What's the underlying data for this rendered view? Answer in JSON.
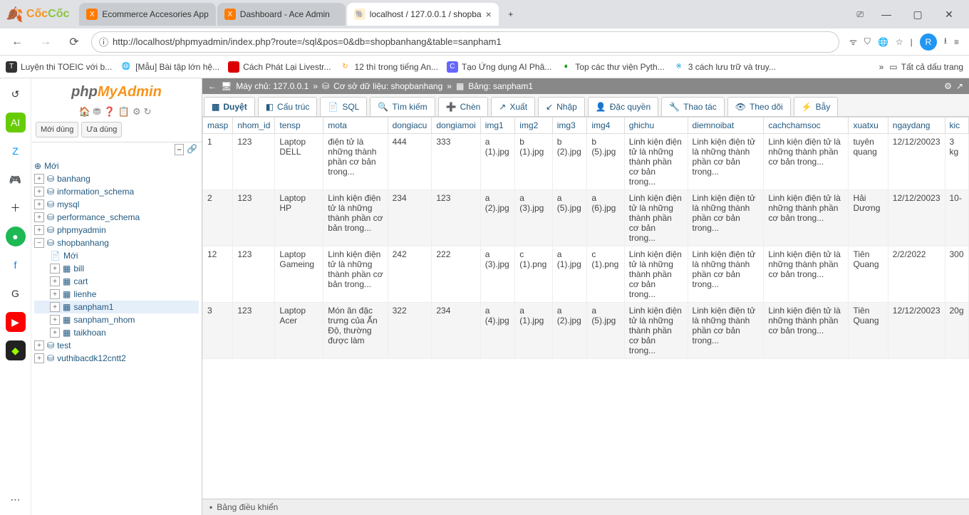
{
  "browser": {
    "brand": "CốcCốc",
    "tabs": [
      {
        "title": "Ecommerce Accesories App",
        "fav": "X",
        "favClass": "orange"
      },
      {
        "title": "Dashboard - Ace Admin",
        "fav": "X",
        "favClass": "orange"
      },
      {
        "title": "localhost / 127.0.0.1 / shopba",
        "fav": "pM",
        "favClass": "pma",
        "active": true
      }
    ],
    "url": "http://localhost/phpmyadmin/index.php?route=/sql&pos=0&db=shopbanhang&table=sanpham1",
    "avatar": "R",
    "bookmarks": [
      {
        "label": "Luyện thi TOEIC với b..."
      },
      {
        "label": "[Mẫu] Bài tập lớn hệ..."
      },
      {
        "label": "Cách Phát Lại Livestr..."
      },
      {
        "label": "12 thì trong tiếng An..."
      },
      {
        "label": "Tạo Ứng dụng AI Phâ..."
      },
      {
        "label": "Top các thư viện Pyth..."
      },
      {
        "label": "3 cách lưu trữ và truy..."
      }
    ],
    "bookmarkAll": "Tất cả dấu trang"
  },
  "pma": {
    "logo": {
      "p1": "php",
      "p2": "MyAdmin"
    },
    "recent": "Mới dùng",
    "favorites": "Ưa dùng",
    "tree": {
      "new": "Mới",
      "dbs": [
        {
          "name": "banhang"
        },
        {
          "name": "information_schema"
        },
        {
          "name": "mysql"
        },
        {
          "name": "performance_schema"
        },
        {
          "name": "phpmyadmin"
        },
        {
          "name": "shopbanhang",
          "expanded": true,
          "children": [
            {
              "name": "Mới",
              "type": "new"
            },
            {
              "name": "bill"
            },
            {
              "name": "cart"
            },
            {
              "name": "lienhe"
            },
            {
              "name": "sanpham1",
              "selected": true
            },
            {
              "name": "sanpham_nhom"
            },
            {
              "name": "taikhoan"
            }
          ]
        },
        {
          "name": "test"
        },
        {
          "name": "vuthibacdk12cntt2"
        }
      ]
    },
    "breadcrumb": {
      "server": "Máy chủ: 127.0.0.1",
      "db": "Cơ sở dữ liệu: shopbanhang",
      "table": "Bảng: sanpham1"
    },
    "tabs": [
      "Duyệt",
      "Cấu trúc",
      "SQL",
      "Tìm kiếm",
      "Chèn",
      "Xuất",
      "Nhập",
      "Đặc quyền",
      "Thao tác",
      "Theo dõi",
      "Bẫy"
    ],
    "columns": [
      "masp",
      "nhom_id",
      "tensp",
      "mota",
      "dongiacu",
      "dongiamoi",
      "img1",
      "img2",
      "img3",
      "img4",
      "ghichu",
      "diemnoibat",
      "cachchamsoc",
      "xuatxu",
      "ngaydang",
      "kic"
    ],
    "longText": "Linh kiện điện tử là những thành phần cơ bản trong...",
    "medText": "Linh kiện điện tử là những thành phần cơ bản trong...",
    "motaRow1": "điện tử là những thành phần cơ bản trong...",
    "motaRow4": "Món ăn đặc trưng của Ấn Độ, thường được làm",
    "rows": [
      {
        "masp": "1",
        "nhom_id": "123",
        "tensp": "Laptop DELL",
        "dongiacu": "444",
        "dongiamoi": "333",
        "img1": "a (1).jpg",
        "img2": "b (1).jpg",
        "img3": "b (2).jpg",
        "img4": "b (5).jpg",
        "xuatxu": "tuyên quang",
        "ngaydang": "12/12/20023",
        "kic": "3 kg"
      },
      {
        "masp": "2",
        "nhom_id": "123",
        "tensp": "Laptop HP",
        "dongiacu": "234",
        "dongiamoi": "123",
        "img1": "a (2).jpg",
        "img2": "a (3).jpg",
        "img3": "a (5).jpg",
        "img4": "a (6).jpg",
        "xuatxu": "Hải Dương",
        "ngaydang": "12/12/20023",
        "kic": "10-"
      },
      {
        "masp": "12",
        "nhom_id": "123",
        "tensp": "Laptop Gameing",
        "dongiacu": "242",
        "dongiamoi": "222",
        "img1": "a (3).jpg",
        "img2": "c (1).png",
        "img3": "a (1).jpg",
        "img4": "c (1).png",
        "xuatxu": "Tiên Quang",
        "ngaydang": "2/2/2022",
        "kic": "300"
      },
      {
        "masp": "3",
        "nhom_id": "123",
        "tensp": "Laptop Acer",
        "dongiacu": "322",
        "dongiamoi": "234",
        "img1": "a (4).jpg",
        "img2": "a (1).jpg",
        "img3": "a (2).jpg",
        "img4": "a (5).jpg",
        "xuatxu": "Tiên Quang",
        "ngaydang": "12/12/20023",
        "kic": "20g"
      }
    ],
    "console": "Bảng điều khiển"
  }
}
